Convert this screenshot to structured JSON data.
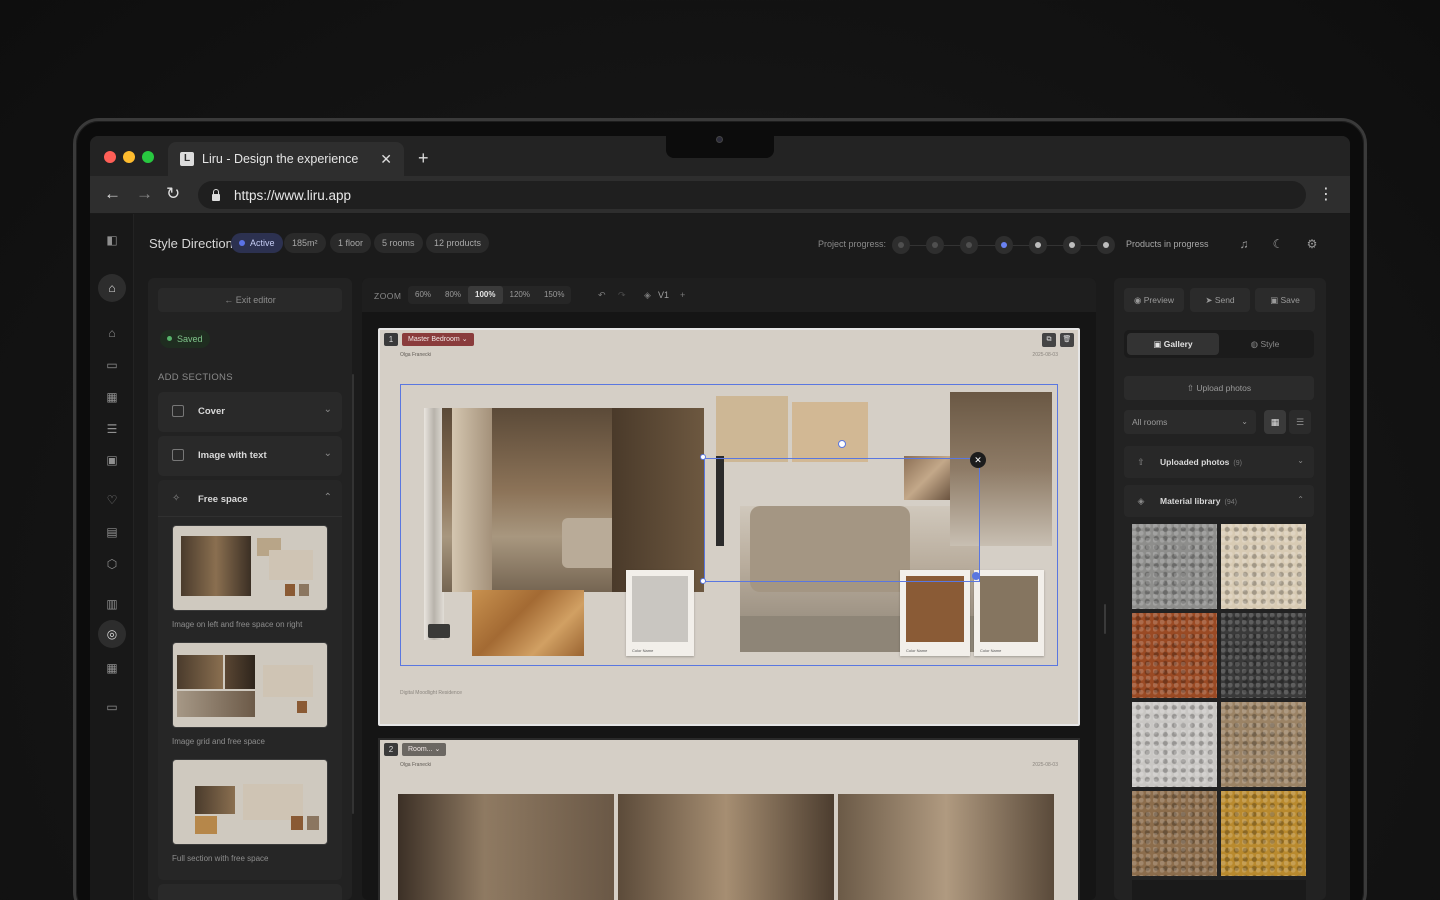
{
  "browser": {
    "tab_title": "Liru - Design the experience",
    "url": "https://www.liru.app"
  },
  "topbar": {
    "title": "Style Direction",
    "chips": [
      "Active",
      "185m²",
      "1 floor",
      "5 rooms",
      "12 products"
    ],
    "progress_label": "Project progress:",
    "progress_status": "Products in progress",
    "progress_steps": [
      "pending",
      "pending",
      "pending",
      "current",
      "done",
      "done",
      "done"
    ]
  },
  "left_panel": {
    "exit_label": "← Exit editor",
    "saved_label": "Saved",
    "add_sections_label": "ADD SECTIONS",
    "sections": [
      {
        "label": "Cover",
        "expanded": false
      },
      {
        "label": "Image with text",
        "expanded": false
      },
      {
        "label": "Free space",
        "expanded": true
      }
    ],
    "templates": [
      {
        "caption": "Image on left and free space on right"
      },
      {
        "caption": "Image grid and free space"
      },
      {
        "caption": "Full section with free space"
      }
    ]
  },
  "canvas": {
    "zoom_label": "ZOOM",
    "zoom_options": [
      "60%",
      "80%",
      "100%",
      "120%",
      "150%"
    ],
    "zoom_selected": "100%",
    "version": "V1",
    "pages": [
      {
        "number": "1",
        "room": "Master Bedroom",
        "author": "Olga Franecki",
        "date": "2025-08-03",
        "footer": "Digital Moodlight Residence",
        "swatch_captions": [
          "Color Name",
          "Color Name",
          "Color Name"
        ]
      },
      {
        "number": "2",
        "room": "Room...",
        "author": "Olga Franecki",
        "date": "2025-08-03"
      }
    ]
  },
  "right_panel": {
    "buttons": [
      "Preview",
      "Send",
      "Save"
    ],
    "tabs": [
      "Gallery",
      "Style"
    ],
    "selected_tab": "Gallery",
    "upload_label": "Upload photos",
    "room_filter": "All rooms",
    "uploaded_label": "Uploaded photos",
    "uploaded_count": "(9)",
    "library_label": "Material library",
    "library_count": "(94)",
    "materials": [
      {
        "name": "grey-granite",
        "color": "#8e8e8c"
      },
      {
        "name": "cream-marble",
        "color": "#d8cbb4"
      },
      {
        "name": "red-granite",
        "color": "#9a4a24"
      },
      {
        "name": "black-granite",
        "color": "#3a3a3a"
      },
      {
        "name": "white-granite",
        "color": "#c9c7c4"
      },
      {
        "name": "brown-granite",
        "color": "#9b8365"
      },
      {
        "name": "sand-granite",
        "color": "#8c6d4c"
      },
      {
        "name": "gold-granite",
        "color": "#b98a2e"
      }
    ]
  },
  "colors": {
    "accent": "#5a77e0",
    "room_tag": "#8a3c3c",
    "saved": "#56b36a"
  }
}
